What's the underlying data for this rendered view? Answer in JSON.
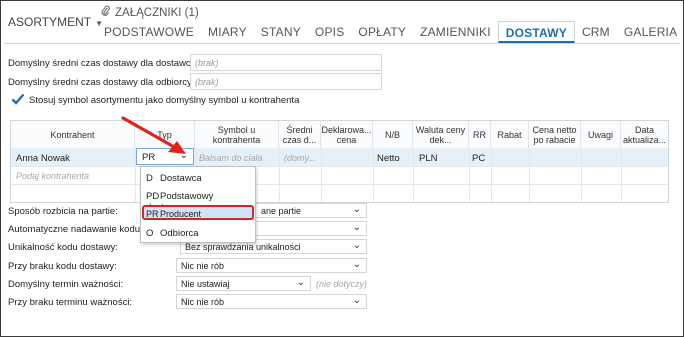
{
  "header": {
    "asortyment_label": "ASORTYMENT",
    "attachments_label": "ZAŁĄCZNIKI (1)",
    "tabs": [
      "PODSTAWOWE",
      "MIARY",
      "STANY",
      "OPIS",
      "OPŁATY",
      "ZAMIENNIKI",
      "DOSTAWY",
      "CRM",
      "GALERIA"
    ],
    "active_tab": "DOSTAWY"
  },
  "top_form": {
    "avg_delivery_supplier_label": "Domyślny średni czas dostawy dla dostawcy:",
    "avg_delivery_supplier_value": "(brak)",
    "avg_delivery_customer_label": "Domyślny średni czas dostawy dla odbiorcy:",
    "avg_delivery_customer_value": "(brak)",
    "use_symbol_label": "Stosuj symbol asortymentu jako domyślny symbol u kontrahenta",
    "use_symbol_checked": true
  },
  "grid": {
    "headers": [
      "Kontrahent",
      "Typ",
      "Symbol u kontrahenta",
      "Średni czas d...",
      "Deklarowa... cena",
      "N/B",
      "Waluta ceny dek...",
      "RR",
      "Rabat",
      "Cena netto po rabacie",
      "Uwagi",
      "Data aktualiza..."
    ],
    "row1": {
      "kontrahent": "Anna Nowak",
      "typ": "PR",
      "symbol_placeholder": "Balsam do ciała",
      "sredni_placeholder": "(domy...",
      "nb": "Netto",
      "waluta": "PLN",
      "rr": "PC"
    },
    "new_row_placeholder": "Podaj kontrahenta"
  },
  "typ_dropdown": {
    "items": [
      {
        "code": "D",
        "label": "Dostawca"
      },
      {
        "code": "PD",
        "label": "Podstawowy dostawca"
      },
      {
        "code": "PR",
        "label": "Producent"
      },
      {
        "code": "O",
        "label": "Odbiorca"
      }
    ],
    "selected": "PR"
  },
  "bottom_form": {
    "split_label": "Sposób rozbicia na partie:",
    "split_value": "ane partie",
    "auto_code_label": "Automatyczne nadawanie kodu d",
    "uniqueness_label": "Unikalność kodu dostawy:",
    "uniqueness_value": "Bez sprawdzania unikalności",
    "no_code_label": "Przy braku kodu dostawy:",
    "no_code_value": "Nic nie rób",
    "default_expiry_label": "Domyślny termin ważności:",
    "default_expiry_value": "Nie ustawiaj",
    "default_expiry_note": "(nie dotyczy)",
    "no_expiry_label": "Przy braku terminu ważności:",
    "no_expiry_value": "Nic nie rób"
  },
  "colors": {
    "accent": "#1e6fb0",
    "highlight_border": "#d8232a",
    "row_selected": "#e6f0f9",
    "dropdown_selected": "#cfe3f3",
    "arrow": "#e2231a"
  }
}
